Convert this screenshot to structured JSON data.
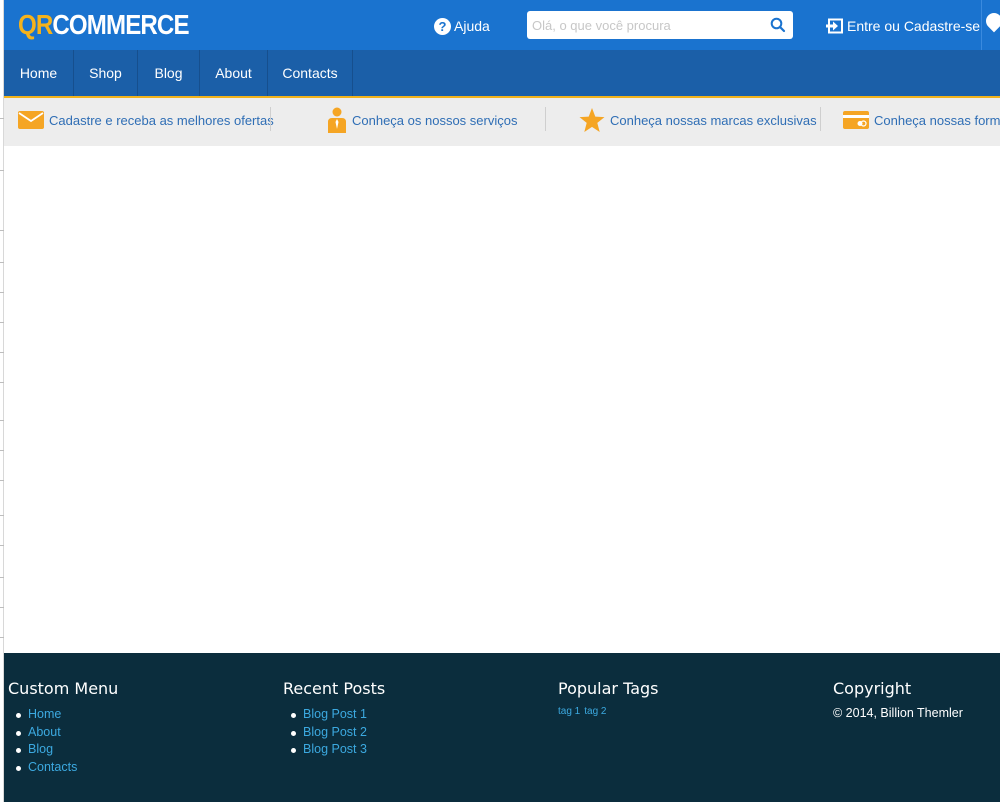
{
  "colors": {
    "topbar": "#1a73cf",
    "navbar": "#1b5fa8",
    "accent": "#f1b31c",
    "footer": "#0b2d3d",
    "link": "#3ca9e0"
  },
  "header": {
    "logo_part1": "QR",
    "logo_part2": "COMMERCE",
    "help_label": "Ajuda",
    "search_placeholder": "Olá, o que você procura",
    "login_label": "Entre ou Cadastre-se"
  },
  "nav": {
    "items": [
      {
        "label": "Home"
      },
      {
        "label": "Shop"
      },
      {
        "label": "Blog"
      },
      {
        "label": "About"
      },
      {
        "label": "Contacts"
      }
    ]
  },
  "benefits": [
    {
      "label": "Cadastre e receba as melhores ofertas",
      "icon": "envelope-icon"
    },
    {
      "label": "Conheça os nossos serviços",
      "icon": "person-icon"
    },
    {
      "label": "Conheça nossas marcas exclusivas",
      "icon": "star-icon"
    },
    {
      "label": "Conheça nossas formas",
      "icon": "credit-card-icon"
    }
  ],
  "footer": {
    "custom_menu": {
      "title": "Custom Menu",
      "items": [
        "Home",
        "About",
        "Blog",
        "Contacts"
      ]
    },
    "recent_posts": {
      "title": "Recent Posts",
      "items": [
        "Blog Post 1",
        "Blog Post 2",
        "Blog Post 3"
      ]
    },
    "popular_tags": {
      "title": "Popular Tags",
      "tags": [
        "tag 1",
        "tag 2"
      ]
    },
    "copyright": {
      "title": "Copyright",
      "text": "© 2014, Billion Themler"
    }
  }
}
